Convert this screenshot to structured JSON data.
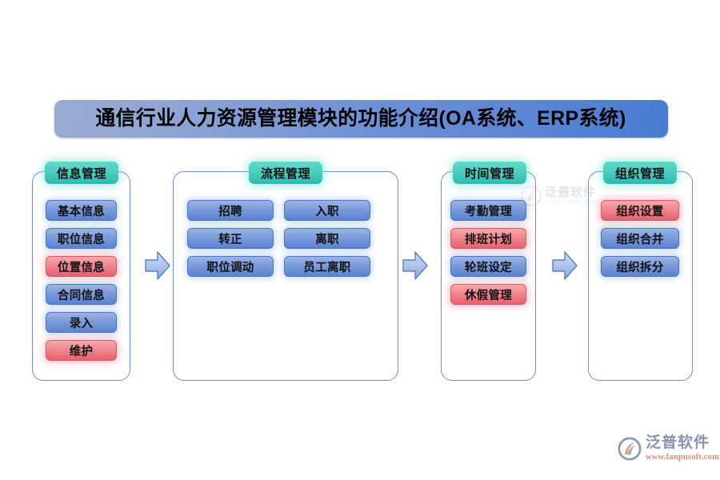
{
  "title": {
    "text": "通信行业人力资源管理模块的功能介绍(OA系统、ERP系统)"
  },
  "columns": [
    {
      "header": "信息管理",
      "groups": [
        {
          "items": [
            {
              "label": "基本信息",
              "color": "blue"
            },
            {
              "label": "职位信息",
              "color": "blue"
            },
            {
              "label": "位置信息",
              "color": "red"
            },
            {
              "label": "合同信息",
              "color": "blue"
            },
            {
              "label": "录入",
              "color": "blue"
            },
            {
              "label": "维护",
              "color": "red"
            }
          ]
        }
      ]
    },
    {
      "header": "流程管理",
      "groups": [
        {
          "items": [
            {
              "label": "招聘",
              "color": "blue"
            },
            {
              "label": "转正",
              "color": "blue"
            },
            {
              "label": "职位调动",
              "color": "blue"
            }
          ]
        },
        {
          "items": [
            {
              "label": "入职",
              "color": "blue"
            },
            {
              "label": "离职",
              "color": "blue"
            },
            {
              "label": "员工离职",
              "color": "blue"
            }
          ]
        }
      ]
    },
    {
      "header": "时间管理",
      "groups": [
        {
          "items": [
            {
              "label": "考勤管理",
              "color": "blue"
            },
            {
              "label": "排班计划",
              "color": "red"
            },
            {
              "label": "轮班设定",
              "color": "blue"
            },
            {
              "label": "休假管理",
              "color": "red"
            }
          ]
        }
      ]
    },
    {
      "header": "组织管理",
      "groups": [
        {
          "items": [
            {
              "label": "组织设置",
              "color": "red"
            },
            {
              "label": "组织合并",
              "color": "blue"
            },
            {
              "label": "组织拆分",
              "color": "blue"
            }
          ]
        }
      ]
    }
  ],
  "arrows": [
    {
      "name": "arrow-col1-to-col2"
    },
    {
      "name": "arrow-col2-to-col3"
    },
    {
      "name": "arrow-col3-to-col4"
    }
  ],
  "watermark": {
    "cn": "泛普软件",
    "en": "FANPU SOFTWARE"
  },
  "logo": {
    "cn": "泛普软件",
    "url": "www.fanpusoft.com"
  },
  "colors": {
    "blue_chip": "#5b82d2",
    "red_chip": "#e4626f",
    "header_green": "#2fb8b2",
    "container_border": "#6d8fd4",
    "title_gradient_start": "#9aabd0",
    "title_gradient_end": "#4a7bd4",
    "arrow_fill": "#a9c0e8"
  }
}
